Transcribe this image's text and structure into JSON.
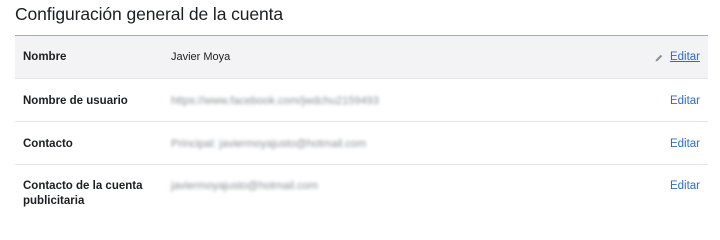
{
  "page": {
    "title": "Configuración general de la cuenta"
  },
  "rows": [
    {
      "label": "Nombre",
      "value": "Javier Moya",
      "edit_label": "Editar"
    },
    {
      "label": "Nombre de usuario",
      "value": "https://www.facebook.com/jwdchu2159493",
      "edit_label": "Editar"
    },
    {
      "label": "Contacto",
      "value": "Principal: javiermoyajusto@hotmail.com",
      "edit_label": "Editar"
    },
    {
      "label_line1": "Contacto de la cuenta",
      "label_line2": "publicitaria",
      "value": "javiermoyajusto@hotmail.com",
      "edit_label": "Editar"
    }
  ],
  "colors": {
    "link": "#2f6cc0",
    "highlight_row": "#f3f3f5",
    "divider": "#e3e5e8"
  },
  "icons": {
    "edit": "pencil-icon"
  }
}
